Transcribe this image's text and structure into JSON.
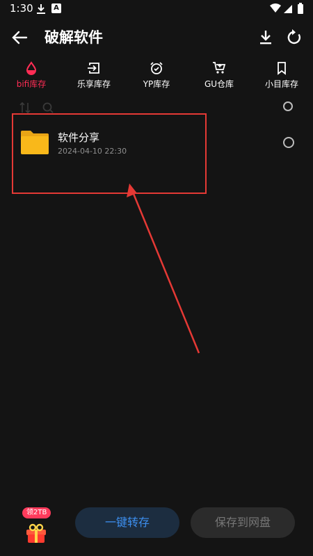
{
  "status_bar": {
    "time": "1:30",
    "icon_letter": "A"
  },
  "app_bar": {
    "title": "破解软件"
  },
  "tabs": [
    {
      "label": "bifi库存",
      "icon": "drop-icon",
      "active": true
    },
    {
      "label": "乐享库存",
      "icon": "login-icon",
      "active": false
    },
    {
      "label": "YP库存",
      "icon": "alarm-clock-icon",
      "active": false
    },
    {
      "label": "GU仓库",
      "icon": "cart-icon",
      "active": false
    },
    {
      "label": "小目库存",
      "icon": "bookmark-icon",
      "active": false
    }
  ],
  "files": [
    {
      "name": "软件分享",
      "date": "2024-04-10 22:30",
      "icon": "folder-icon"
    }
  ],
  "bottom": {
    "gift_badge": "领2TB",
    "transfer_label": "一键转存",
    "save_label": "保存到网盘"
  },
  "colors": {
    "background": "#141414",
    "accent": "#ff2d55",
    "primary_button_text": "#3d8fef",
    "highlight_border": "#e53935",
    "folder": "#f9b81a"
  }
}
